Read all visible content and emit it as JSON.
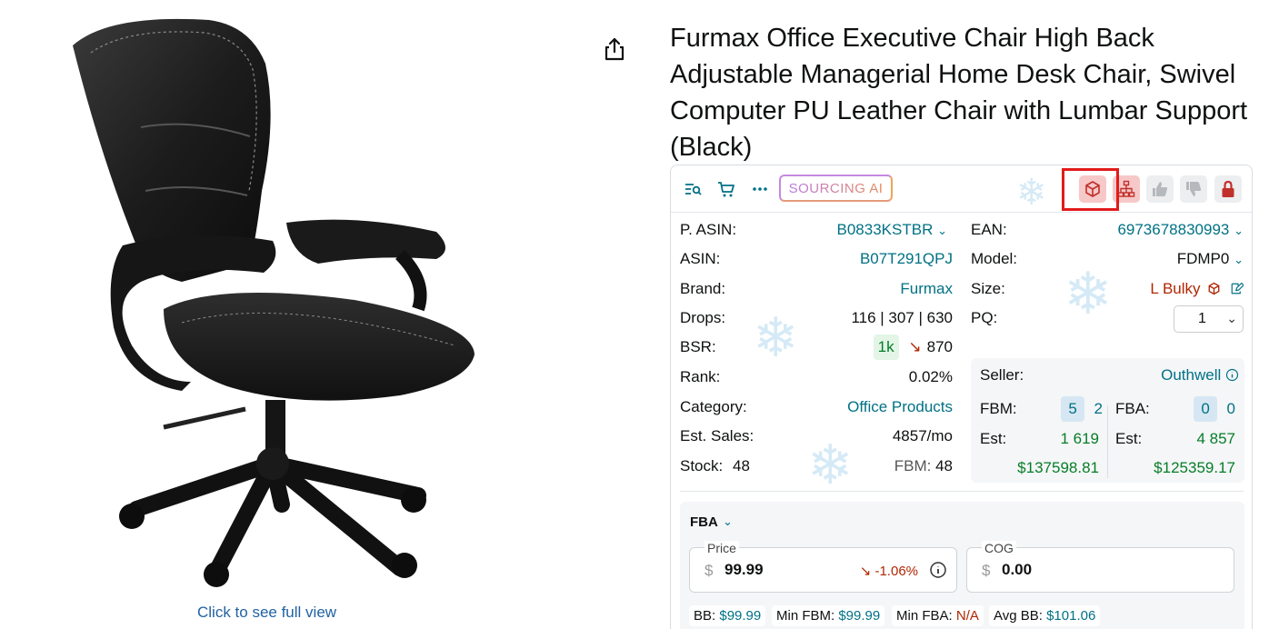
{
  "product": {
    "title": "Furmax Office Executive Chair High Back Adjustable Managerial Home Desk Chair, Swivel Computer PU Leather Chair with Lumbar Support (Black)",
    "full_view_link": "Click to see full view"
  },
  "toolbar": {
    "sourcing_label": "SOURCING AI",
    "icons": [
      "list-search-icon",
      "cart-icon",
      "more-icon",
      "package-icon",
      "sitemap-icon",
      "thumbs-up-icon",
      "thumbs-down-icon",
      "lock-icon"
    ]
  },
  "details": {
    "p_asin": {
      "label": "P. ASIN:",
      "value": "B0833KSTBR"
    },
    "asin": {
      "label": "ASIN:",
      "value": "B07T291QPJ"
    },
    "brand": {
      "label": "Brand:",
      "value": "Furmax"
    },
    "drops": {
      "label": "Drops:",
      "value": "116 | 307 | 630"
    },
    "bsr": {
      "label": "BSR:",
      "badge": "1k",
      "value": "870"
    },
    "rank": {
      "label": "Rank:",
      "value": "0.02%"
    },
    "category": {
      "label": "Category:",
      "value": "Office Products"
    },
    "est_sales": {
      "label": "Est. Sales:",
      "value": "4857/mo"
    },
    "stock": {
      "label": "Stock:",
      "value": "48"
    },
    "fbm_stock": {
      "label": "FBM:",
      "value": "48"
    },
    "ean": {
      "label": "EAN:",
      "value": "6973678830993"
    },
    "model": {
      "label": "Model:",
      "value": "FDMP0"
    },
    "size": {
      "label": "Size:",
      "value": "L Bulky"
    },
    "pq": {
      "label": "PQ:",
      "value": "1"
    }
  },
  "seller": {
    "label": "Seller:",
    "name": "Outhwell",
    "fbm": {
      "label": "FBM:",
      "count": "5",
      "count2": "2"
    },
    "fba": {
      "label": "FBA:",
      "count": "0",
      "count2": "0"
    },
    "est_fbm": {
      "label": "Est:",
      "units": "1 619",
      "revenue": "$137598.81"
    },
    "est_fba": {
      "label": "Est:",
      "units": "4 857",
      "revenue": "$125359.17"
    }
  },
  "fba": {
    "label": "FBA",
    "price": {
      "legend": "Price",
      "currency": "$",
      "value": "99.99",
      "change": "-1.06%"
    },
    "cog": {
      "legend": "COG",
      "currency": "$",
      "value": "0.00"
    },
    "stats": {
      "bb": {
        "label": "BB:",
        "value": "$99.99"
      },
      "min_fbm": {
        "label": "Min FBM:",
        "value": "$99.99"
      },
      "min_fba": {
        "label": "Min FBA:",
        "value": "N/A"
      },
      "avg_bb": {
        "label": "Avg BB:",
        "value": "$101.06"
      }
    }
  },
  "colors": {
    "link": "#007185",
    "green": "#067d28",
    "red": "#b12704",
    "highlight": "#e11b1b"
  }
}
